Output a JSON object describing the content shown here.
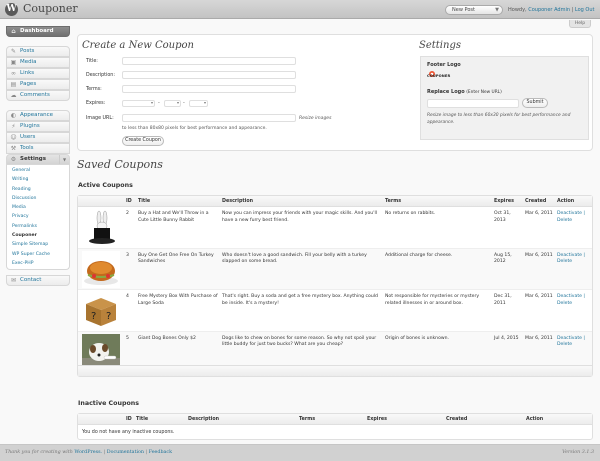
{
  "header": {
    "site_title": "Couponer",
    "new_post_label": "New Post",
    "howdy_prefix": "Howdy,",
    "user_name": "Couponer Admin",
    "separator": "|",
    "logout_label": "Log Out",
    "help_label": "Help"
  },
  "menu": {
    "dashboard": "Dashboard",
    "posts": "Posts",
    "media": "Media",
    "links": "Links",
    "pages": "Pages",
    "comments": "Comments",
    "appearance": "Appearance",
    "plugins": "Plugins",
    "users": "Users",
    "tools": "Tools",
    "settings": "Settings",
    "contact": "Contact",
    "settings_submenu": [
      "General",
      "Writing",
      "Reading",
      "Discussion",
      "Media",
      "Privacy",
      "Permalinks",
      "Couponer",
      "Simple Sitemap",
      "WP Super Cache",
      "Exec-PHP"
    ]
  },
  "create_form": {
    "title": "Create a New Coupon",
    "label_title": "Title:",
    "label_description": "Description:",
    "label_terms": "Terms:",
    "label_expires": "Expires:",
    "label_image_url": "Image URL:",
    "resize_hint_suffix": "Resize images",
    "resize_hint": "to less than 80x80 pixels for best performance and appearance.",
    "create_button": "Create Coupon"
  },
  "settings": {
    "title": "Settings",
    "footer_logo_label": "Footer Logo",
    "logo_text": "COUPONER",
    "replace_logo_label": "Replace Logo",
    "replace_logo_note": "(Enter New URL)",
    "submit_button": "Submit",
    "resize_note": "Resize image to less than 60x30 pixels for best performance and appearance."
  },
  "saved": {
    "title": "Saved Coupons",
    "active_title": "Active Coupons",
    "inactive_title": "Inactive Coupons",
    "no_inactive": "You do not have any inactive coupons."
  },
  "table_headers": {
    "id": "ID",
    "title": "Title",
    "description": "Description",
    "terms": "Terms",
    "expires": "Expires",
    "created": "Created",
    "action": "Action"
  },
  "active_coupons": [
    {
      "id": "2",
      "title": "Buy a Hat and We'll Throw in a Cute Little Bunny Rabbit",
      "description": "Now you can impress your friends with your magic skills. And you'll have a new furry best friend.",
      "terms": "No returns on rabbits.",
      "expires": "Oct 31, 2013",
      "created": "Mar 6, 2011"
    },
    {
      "id": "3",
      "title": "Buy One Get One Free On Turkey Sandwiches",
      "description": "Who doesn't love a good sandwich. Fill your belly with a turkey slapped on some bread.",
      "terms": "Additional charge for cheese.",
      "expires": "Aug 15, 2012",
      "created": "Mar 6, 2011"
    },
    {
      "id": "4",
      "title": "Free Mystery Box With Purchase of Large Soda",
      "description": "That's right. Buy a soda and get a free mystery box. Anything could be inside. It's a mystery!",
      "terms": "Not responsible for mysteries or mystery related illnesses in or around box.",
      "expires": "Dec 31, 2011",
      "created": "Mar 6, 2011"
    },
    {
      "id": "5",
      "title": "Giant Dog Bones Only $2",
      "description": "Dogs like to chew on bones for some reason. So why not spoil your little buddy for just two bucks? What are you cheap?",
      "terms": "Origin of bones is unknown.",
      "expires": "Jul 4, 2015",
      "created": "Mar 6, 2011"
    }
  ],
  "actions": {
    "deactivate": "Deactivate |",
    "delete": "Delete"
  },
  "footer": {
    "thank_you": "Thank you for creating with",
    "wordpress": "WordPress.",
    "sep": "|",
    "documentation": "Documentation",
    "feedback": "Feedback",
    "version": "Version 3.1.3"
  },
  "colors": {
    "link": "#21759b",
    "menu_current": "#7a7a7a",
    "header_bg": "#cfcfcf"
  }
}
